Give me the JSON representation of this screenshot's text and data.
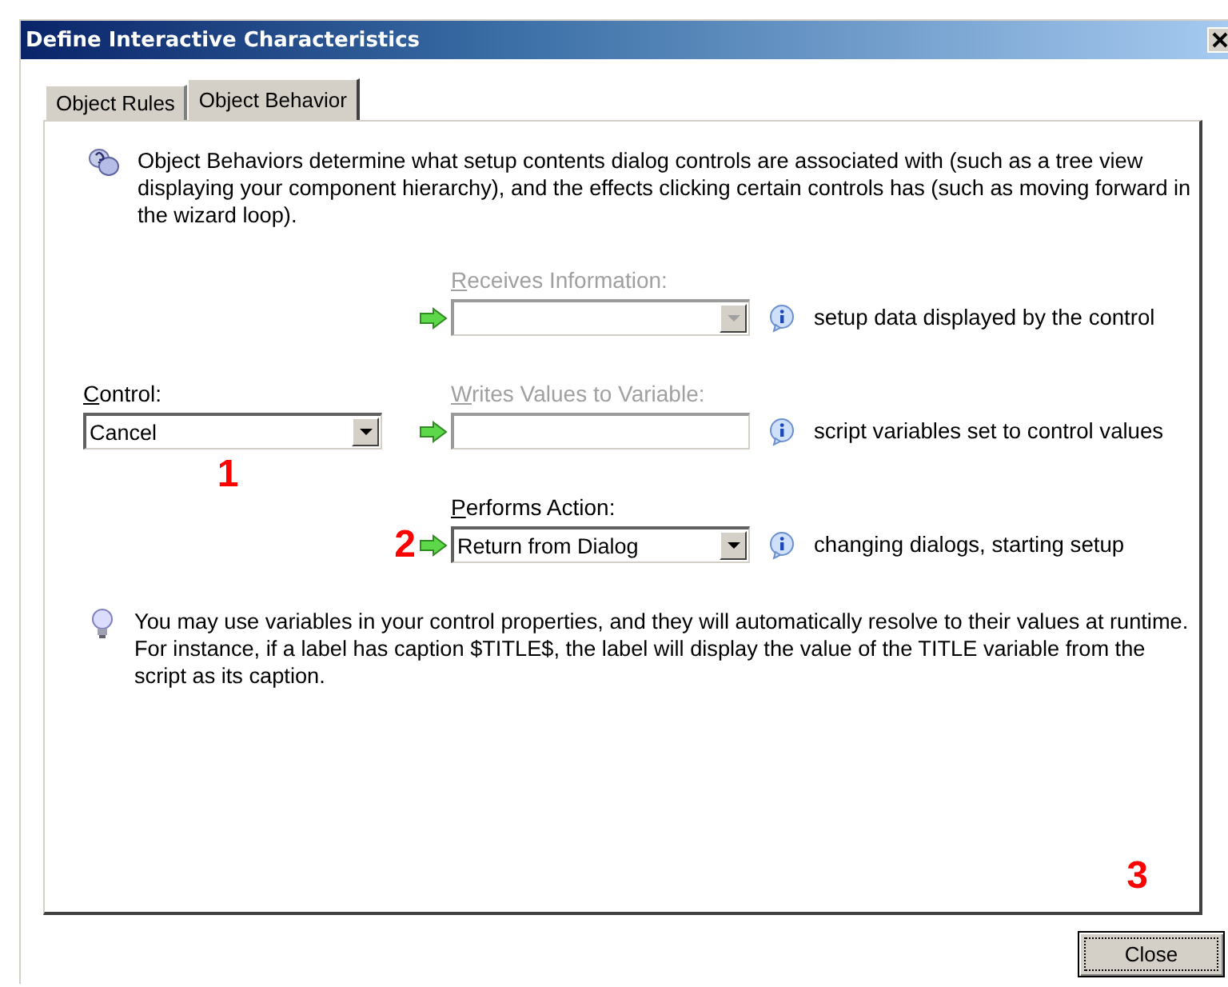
{
  "window": {
    "title": "Define Interactive Characteristics"
  },
  "tabs": [
    {
      "label": "Object Rules",
      "selected": false
    },
    {
      "label": "Object Behavior",
      "selected": true
    }
  ],
  "intro": "Object Behaviors determine what setup contents dialog controls are associated with (such as a tree view displaying your component hierarchy), and the effects clicking certain controls has (such as moving forward in the wizard loop).",
  "rows": [
    {
      "label": "Receives Information:",
      "kind": "combobox",
      "disabled": true,
      "hint": "setup data displayed by the control"
    },
    {
      "label": "Writes Values to Variable:",
      "kind": "textbox",
      "disabled": true,
      "hint": "script variables set to control values",
      "left": {
        "label": "Control:",
        "value": "Cancel",
        "annotation": "1"
      }
    },
    {
      "label": "Performs Action:",
      "kind": "combobox",
      "disabled": false,
      "value": "Return from Dialog",
      "hint": "changing dialogs, starting setup",
      "annotation": "2"
    }
  ],
  "tip": "You may use variables in your control properties, and they will automatically resolve to their values at runtime. For instance, if a label has caption $TITLE$, the label will display the value of the TITLE variable from the script as its caption.",
  "panel_annotation": "3",
  "buttons": [
    {
      "label": "Close"
    }
  ]
}
